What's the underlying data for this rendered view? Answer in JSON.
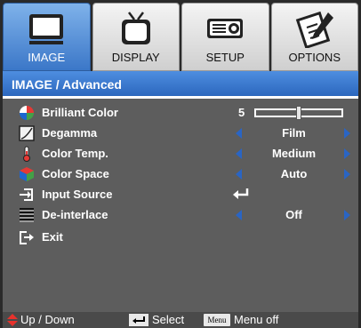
{
  "tabs": [
    {
      "label": "IMAGE",
      "icon": "monitor-icon",
      "active": true
    },
    {
      "label": "DISPLAY",
      "icon": "tv-icon",
      "active": false
    },
    {
      "label": "SETUP",
      "icon": "projector-icon",
      "active": false
    },
    {
      "label": "OPTIONS",
      "icon": "notepad-pencil-icon",
      "active": false
    }
  ],
  "header": {
    "title": "IMAGE / Advanced"
  },
  "menu": {
    "brilliant_color": {
      "label": "Brilliant Color",
      "value": "5",
      "level_fraction": 0.5
    },
    "degamma": {
      "label": "Degamma",
      "value": "Film"
    },
    "color_temp": {
      "label": "Color Temp.",
      "value": "Medium"
    },
    "color_space": {
      "label": "Color Space",
      "value": "Auto"
    },
    "input_source": {
      "label": "Input Source"
    },
    "de_interlace": {
      "label": "De-interlace",
      "value": "Off"
    },
    "exit": {
      "label": "Exit"
    }
  },
  "footer": {
    "updown": "Up / Down",
    "select": "Select",
    "menu_key": "Menu",
    "menu_off": "Menu off"
  },
  "colors": {
    "accent": "#2c67be",
    "arrow": "#2a65c4",
    "panel": "#5d5d5d",
    "updown_icon": "#e8322c"
  }
}
